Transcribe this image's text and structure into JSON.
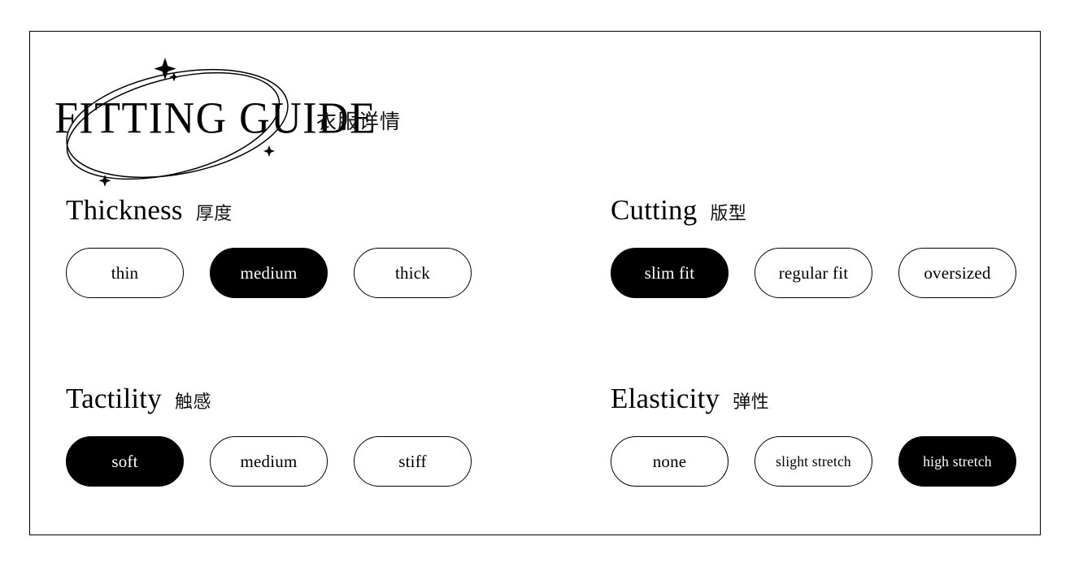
{
  "page": {
    "background_color": "#ffffff",
    "frame_color": "#000000",
    "accent_selected_bg": "#000000",
    "accent_selected_fg": "#ffffff"
  },
  "header": {
    "title": "FITTING GUIDE",
    "title_cn": "衣服详情",
    "decoration": "double-ellipse-with-sparkles"
  },
  "sections": [
    {
      "id": "thickness",
      "title": "Thickness",
      "title_cn": "厚度",
      "options": [
        {
          "label": "thin",
          "selected": false,
          "small": false
        },
        {
          "label": "medium",
          "selected": true,
          "small": false
        },
        {
          "label": "thick",
          "selected": false,
          "small": false
        }
      ]
    },
    {
      "id": "cutting",
      "title": "Cutting",
      "title_cn": "版型",
      "options": [
        {
          "label": "slim fit",
          "selected": true,
          "small": false
        },
        {
          "label": "regular fit",
          "selected": false,
          "small": false
        },
        {
          "label": "oversized",
          "selected": false,
          "small": false
        }
      ]
    },
    {
      "id": "tactility",
      "title": "Tactility",
      "title_cn": "触感",
      "options": [
        {
          "label": "soft",
          "selected": true,
          "small": false
        },
        {
          "label": "medium",
          "selected": false,
          "small": false
        },
        {
          "label": "stiff",
          "selected": false,
          "small": false
        }
      ]
    },
    {
      "id": "elasticity",
      "title": "Elasticity",
      "title_cn": "弹性",
      "options": [
        {
          "label": "none",
          "selected": false,
          "small": false
        },
        {
          "label": "slight stretch",
          "selected": false,
          "small": true
        },
        {
          "label": "high stretch",
          "selected": true,
          "small": true
        }
      ]
    }
  ]
}
